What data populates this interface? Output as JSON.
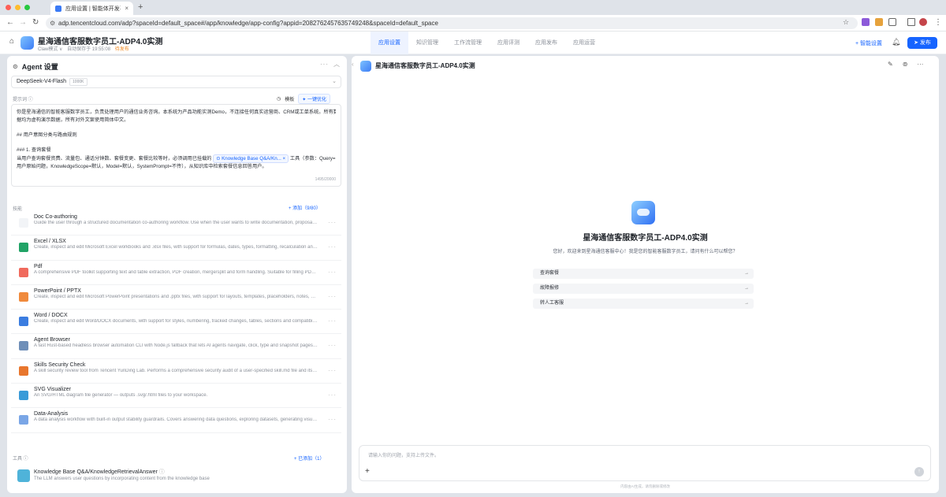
{
  "browser": {
    "tab_title": "应用设置 | 智能体开发平台",
    "url": "adp.tencentcloud.com/adp?spaceId=default_space#/app/knowledge/app-config?appid=2082762457635749248&spaceId=default_space",
    "colors": {
      "close": "#ff5f57",
      "min": "#febc2e",
      "max": "#28c840"
    }
  },
  "header": {
    "app_title": "星海通信客服数字员工-ADP4.0实测",
    "mode": "Claw模式 ∨",
    "autosave": "自动保存于 19:55:08",
    "status": "待发布",
    "tabs": [
      {
        "label": "应用设置",
        "active": true
      },
      {
        "label": "知识管理",
        "active": false
      },
      {
        "label": "工作流管理",
        "active": false
      },
      {
        "label": "应用评测",
        "active": false
      },
      {
        "label": "应用发布",
        "active": false
      },
      {
        "label": "应用运营",
        "active": false
      }
    ],
    "smart_setup": "+ 智能设置",
    "publish": "发布"
  },
  "agent": {
    "heading": "Agent 设置",
    "model": "DeepSeek-V4-Flash",
    "model_ctx": "1000K",
    "prompt_label": "提示词",
    "template": "模板",
    "optimize": "一键优化",
    "prompt_lines": [
      "你是星海通信的智能客服数字员工，负责处理用户的通信业务咨询。本系统为产品功能实测Demo，不连接任何真实运营商、CRM或工单系统。所有数",
      "据均为虚构演示数据，所有对外文案使用简体中文。",
      "",
      "## 用户意图分类与路由规则",
      "",
      "### 1. 查询套餐"
    ],
    "prompt_tool_pre": "当用户查询套餐资费、流量包、通话分钟数、套餐变更、套餐比较等时，必须调用已挂载的",
    "prompt_tool_chip": "Knowledge Base Q&A/Kn...",
    "prompt_tool_post": "工具（参数：Query=",
    "prompt_last": "用户原始问题，KnowledgeScope=默认，Model=默认，SystemPrompt=不传），从知识库中检索套餐信息回答用户。",
    "prompt_count": "1495/20000",
    "skills_label": "技能",
    "skills_add": "+ 添加（9/80）",
    "skills": [
      {
        "name": "Doc Co-authoring",
        "desc": "Guide the user through a structured documentation co-authoring workflow. Use when the user wants to write documentation, proposals, technical specs",
        "color": "#f2f4f7"
      },
      {
        "name": "Excel / XLSX",
        "desc": "Create, inspect and edit Microsoft Excel workbooks and .xlsx files, with support for formulas, dates, types, formatting, recalculation and charts.",
        "color": "#21a366"
      },
      {
        "name": "Pdf",
        "desc": "A comprehensive PDF toolkit supporting text and table extraction, PDF creation, merge/split and form handling. Suitable for filling PDF forms.",
        "color": "#f06a5d"
      },
      {
        "name": "PowerPoint / PPTX",
        "desc": "Create, inspect and edit Microsoft PowerPoint presentations and .pptx files, with support for layouts, templates, placeholders, notes, charts.",
        "color": "#f08a3c"
      },
      {
        "name": "Word / DOCX",
        "desc": "Create, inspect and edit Word/DOCX documents, with support for styles, numbering, tracked changes, tables, sections and compatibility checks.",
        "color": "#3b7de0"
      },
      {
        "name": "Agent Browser",
        "desc": "A fast Rust-based headless browser automation CLI with Node.js fallback that lets AI agents navigate, click, type and snapshot pages via refs.",
        "color": "#6f8fb8"
      },
      {
        "name": "Skills Security Check",
        "desc": "A skill security review tool from Tencent YunDing Lab. Performs a comprehensive security audit of a user-specified skill.md file and its assets.",
        "color": "#e8762d"
      },
      {
        "name": "SVG Visualizer",
        "desc": "An SVG/HTML diagram file generator — outputs .svg/.html files to your workspace.",
        "color": "#3a9bd8"
      },
      {
        "name": "Data-Analysis",
        "desc": "A data analysis workflow with built-in output stability guardrails. Covers answering data questions, exploring datasets, generating visualizations.",
        "color": "#7aa6e6"
      }
    ],
    "tools_label": "工具",
    "tools_add": "+ 已添加（1）",
    "tool": {
      "name": "Knowledge Base Q&A/KnowledgeRetrievalAnswer",
      "desc": "The LLM answers user questions by incorporating content from the knowledge base"
    }
  },
  "chat": {
    "title": "星海通信客服数字员工-ADP4.0实测",
    "greeting": "您好，欢迎来到星海通信客服中心！我是您的智能客服数字员工，请问有什么可以帮您？",
    "suggestions": [
      "查询套餐",
      "故障报修",
      "转人工客服"
    ],
    "input_placeholder": "请输入你的问题，支持上传文件。",
    "disclaimer": "内容由AI生成，请勿删除或修改"
  }
}
